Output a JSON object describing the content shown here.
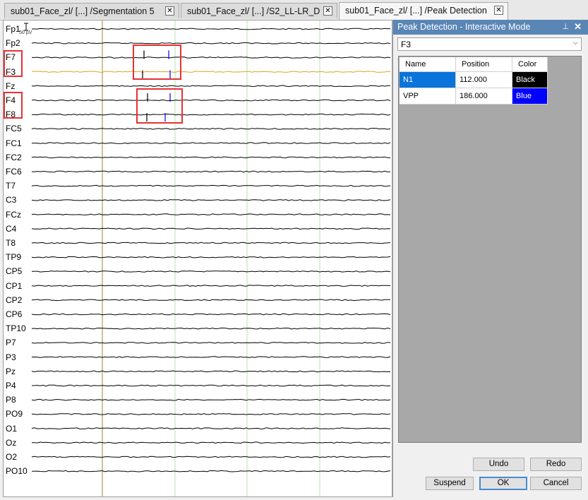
{
  "tabs": [
    {
      "label": "sub01_Face_zl/ [...] /Segmentation 5",
      "active": false
    },
    {
      "label": "sub01_Face_zl/ [...] /S2_LL-LR_D",
      "active": false
    },
    {
      "label": "sub01_Face_zl/ [...] /Peak Detection",
      "active": true
    }
  ],
  "tab_close_glyph": "✕",
  "eeg": {
    "scale_label": "50 µV",
    "channels": [
      "Fp1",
      "Fp2",
      "F7",
      "F3",
      "Fz",
      "F4",
      "F8",
      "FC5",
      "FC1",
      "FC2",
      "FC6",
      "T7",
      "C3",
      "FCz",
      "C4",
      "T8",
      "TP9",
      "CP5",
      "CP1",
      "CP2",
      "CP6",
      "TP10",
      "P7",
      "P3",
      "Pz",
      "P4",
      "P8",
      "PO9",
      "O1",
      "Oz",
      "O2",
      "PO10"
    ],
    "highlighted_channel": "F3",
    "colors": {
      "trace": "#000000",
      "highlight_trace": "#e0a020",
      "cursor": "#a08040",
      "marker_line": "#b8e0b0",
      "peak_marker": "#0000ff",
      "red_box": "#e53333"
    }
  },
  "panel": {
    "title": "Peak Detection - Interactive Mode",
    "pin_icon": "pin-icon",
    "close_glyph": "✕",
    "channel_select": "F3",
    "columns": [
      "Name",
      "Position",
      "Color"
    ],
    "rows": [
      {
        "name": "N1",
        "position": "112.000",
        "color": "Black",
        "swatch": "#000000",
        "selected": true
      },
      {
        "name": "VPP",
        "position": "186.000",
        "color": "Blue",
        "swatch": "#0000ff",
        "selected": false
      }
    ],
    "buttons": {
      "undo": "Undo",
      "redo": "Redo",
      "suspend": "Suspend",
      "ok": "OK",
      "cancel": "Cancel"
    }
  }
}
